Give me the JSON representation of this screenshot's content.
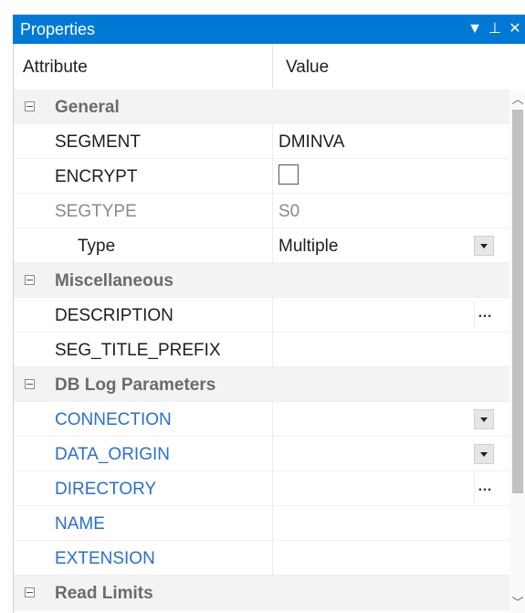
{
  "panel": {
    "title": "Properties",
    "buttons": {
      "dropdown": "▼",
      "pin": "⊥",
      "close": "✕"
    }
  },
  "grid": {
    "header": {
      "attribute": "Attribute",
      "value": "Value"
    },
    "categories": [
      {
        "label": "General",
        "properties": [
          {
            "name": "SEGMENT",
            "value": "DMINVA"
          },
          {
            "name": "ENCRYPT",
            "value": ""
          },
          {
            "name": "SEGTYPE",
            "value": "S0"
          },
          {
            "name": "Type",
            "value": "Multiple"
          }
        ]
      },
      {
        "label": "Miscellaneous",
        "properties": [
          {
            "name": "DESCRIPTION",
            "value": ""
          },
          {
            "name": "SEG_TITLE_PREFIX",
            "value": ""
          }
        ]
      },
      {
        "label": "DB Log Parameters",
        "properties": [
          {
            "name": "CONNECTION",
            "value": ""
          },
          {
            "name": "DATA_ORIGIN",
            "value": ""
          },
          {
            "name": "DIRECTORY",
            "value": ""
          },
          {
            "name": "NAME",
            "value": ""
          },
          {
            "name": "EXTENSION",
            "value": ""
          }
        ]
      },
      {
        "label": "Read Limits",
        "properties": []
      }
    ]
  },
  "icons": {
    "collapse": "minus-box-icon",
    "dropdown": "chevron-down-icon",
    "ellipsis": "ellipsis-icon"
  },
  "colors": {
    "title_bar": "#0079d6",
    "linked_property": "#2a6fd0",
    "readonly_property": "#8a8a8a",
    "category_background": "#f3f3f3"
  }
}
